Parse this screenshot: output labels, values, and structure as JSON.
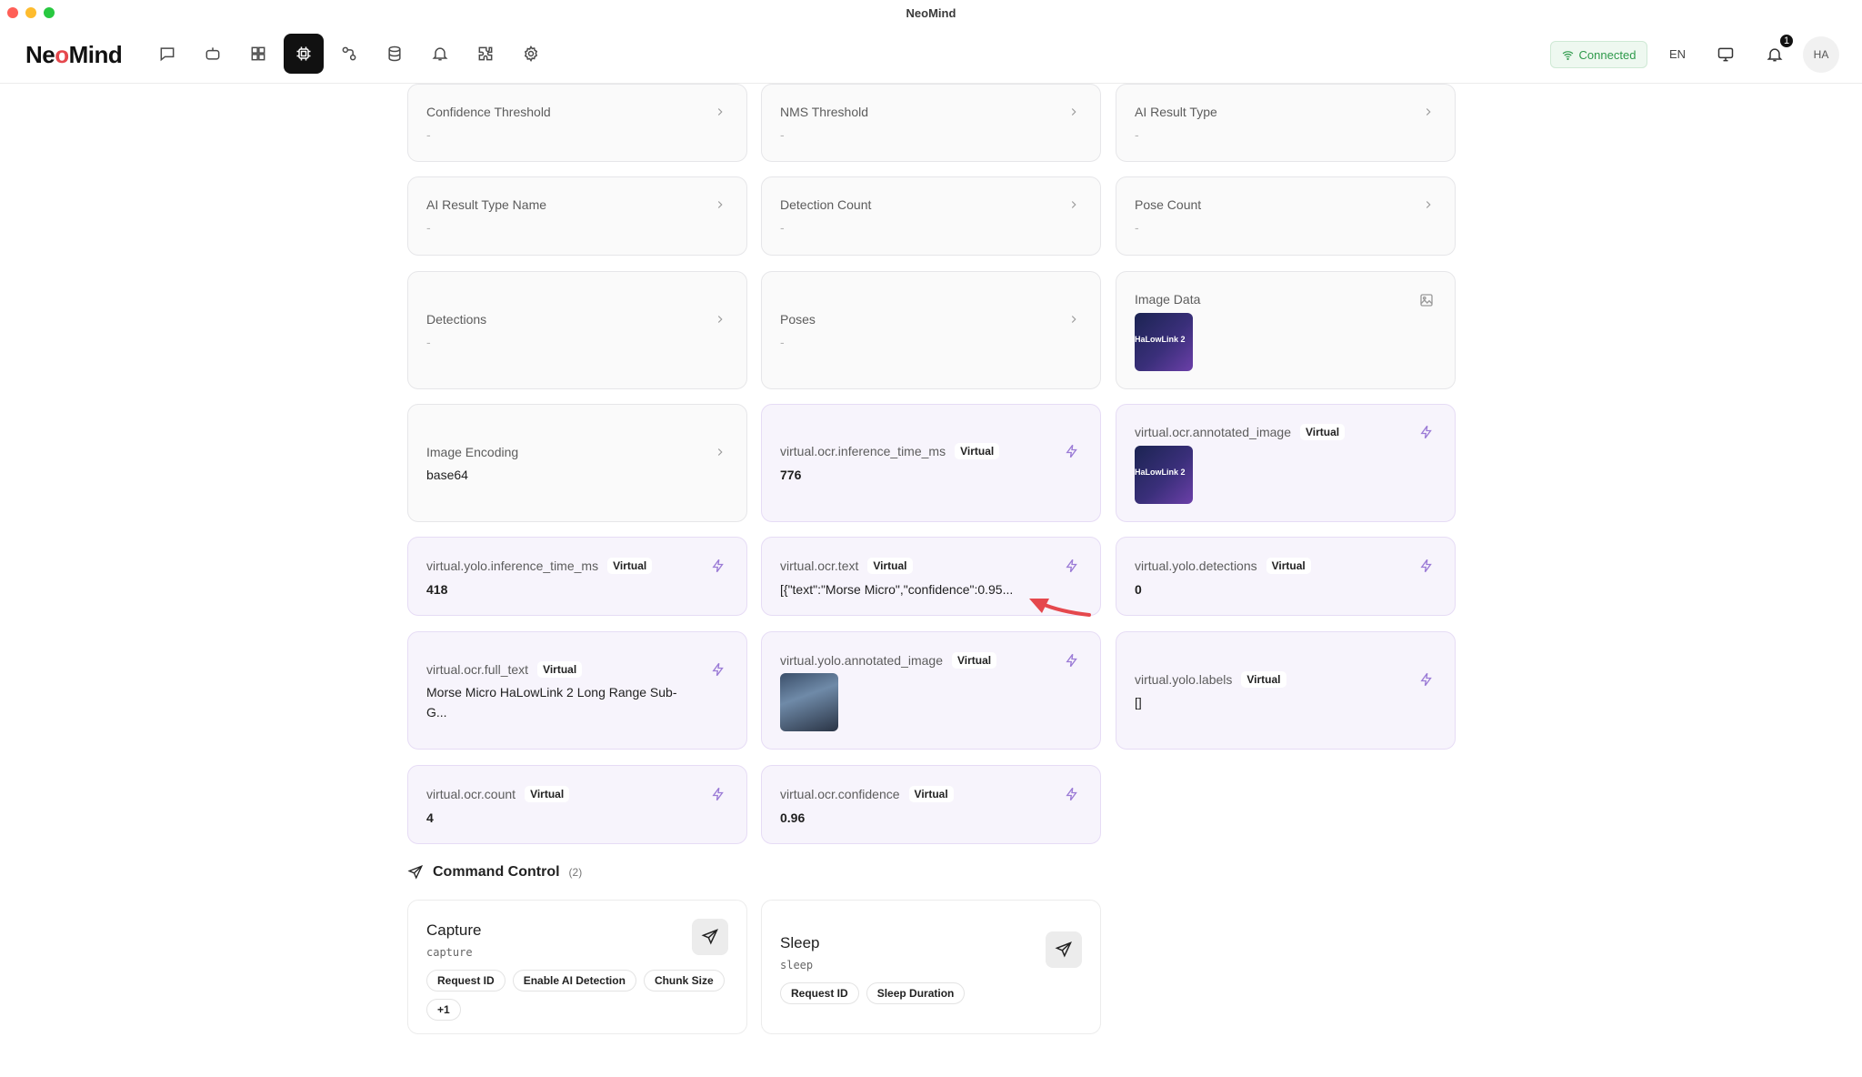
{
  "window": {
    "title": "NeoMind"
  },
  "header": {
    "logo_left": "Ne",
    "logo_o": "o",
    "logo_right": "Mind",
    "nav": [
      {
        "name": "chat-icon"
      },
      {
        "name": "robot-icon"
      },
      {
        "name": "dashboard-icon"
      },
      {
        "name": "device-chip-icon",
        "active": true
      },
      {
        "name": "workflow-icon"
      },
      {
        "name": "database-icon"
      },
      {
        "name": "bell-icon"
      },
      {
        "name": "plugin-icon"
      },
      {
        "name": "gear-icon"
      }
    ],
    "status": "Connected",
    "language": "EN",
    "notification_count": "1",
    "avatar": "HA"
  },
  "metrics": [
    {
      "label": "Confidence Threshold",
      "value": "-"
    },
    {
      "label": "NMS Threshold",
      "value": "-"
    },
    {
      "label": "AI Result Type",
      "value": "-"
    },
    {
      "label": "AI Result Type Name",
      "value": "-"
    },
    {
      "label": "Detection Count",
      "value": "-"
    },
    {
      "label": "Pose Count",
      "value": "-"
    },
    {
      "label": "Detections",
      "value": "-"
    },
    {
      "label": "Poses",
      "value": "-"
    },
    {
      "label": "Image Data",
      "thumb_text": "HaLowLink 2"
    },
    {
      "label": "Image Encoding",
      "value": "base64"
    },
    {
      "label": "virtual.ocr.inference_time_ms",
      "value": "776"
    },
    {
      "label": "virtual.ocr.annotated_image",
      "thumb_text": "HaLowLink 2"
    },
    {
      "label": "virtual.yolo.inference_time_ms",
      "value": "418"
    },
    {
      "label": "virtual.ocr.text",
      "value": "[{\"text\":\"Morse Micro\",\"confidence\":0.95..."
    },
    {
      "label": "virtual.yolo.detections",
      "value": "0"
    },
    {
      "label": "virtual.ocr.full_text",
      "value_line1": "Morse Micro HaLowLink 2 Long Range Sub-",
      "value_line2": "G..."
    },
    {
      "label": "virtual.yolo.annotated_image"
    },
    {
      "label": "virtual.yolo.labels",
      "value": "[]"
    },
    {
      "label": "virtual.ocr.count",
      "value": "4"
    },
    {
      "label": "virtual.ocr.confidence",
      "value": "0.96"
    }
  ],
  "virtual_tag": "Virtual",
  "commands": {
    "title": "Command Control",
    "count": "(2)",
    "items": [
      {
        "title": "Capture",
        "code": "capture",
        "chips": [
          "Request ID",
          "Enable AI Detection",
          "Chunk Size",
          "+1"
        ]
      },
      {
        "title": "Sleep",
        "code": "sleep",
        "chips": [
          "Request ID",
          "Sleep Duration"
        ]
      }
    ]
  },
  "colors": {
    "accent_virtual": "#9b7bd6",
    "connected": "#2e9a4b",
    "arrow": "#e5484d"
  }
}
